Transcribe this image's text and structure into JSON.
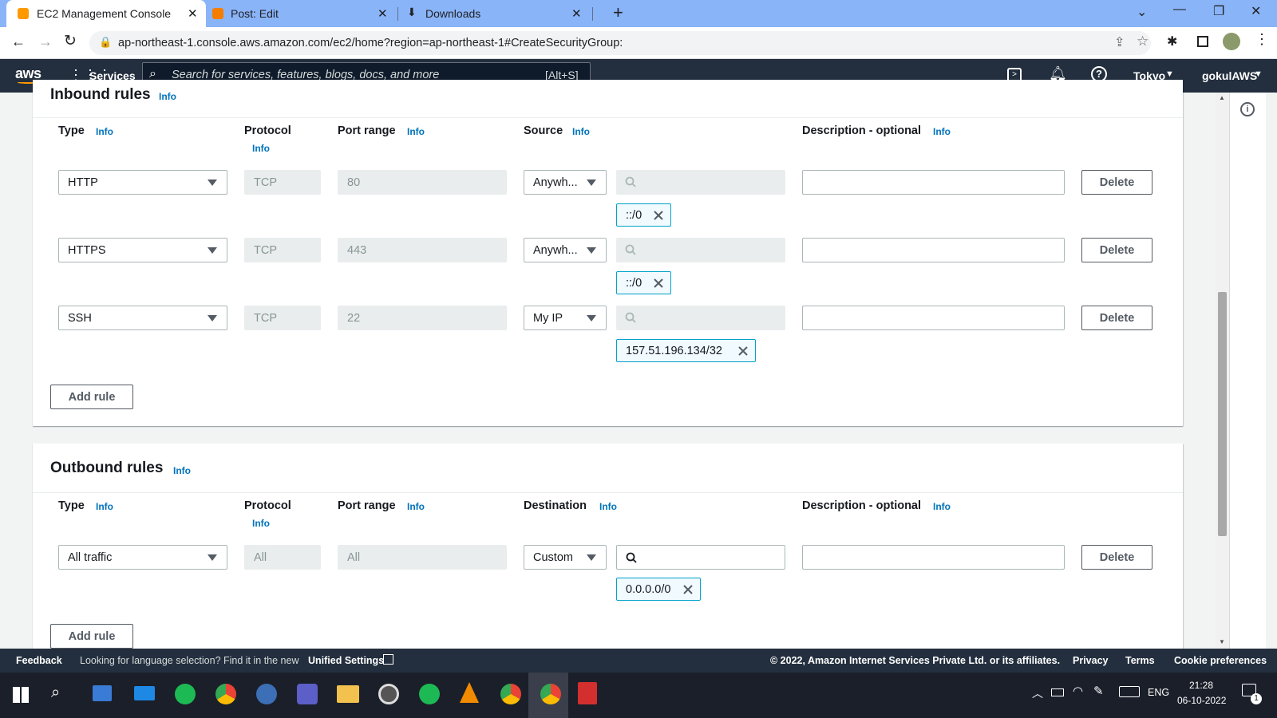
{
  "browser": {
    "tabs": [
      {
        "title": "EC2 Management Console",
        "active": true
      },
      {
        "title": "Post: Edit",
        "active": false
      },
      {
        "title": "Downloads",
        "active": false
      }
    ],
    "url": "ap-northeast-1.console.aws.amazon.com/ec2/home?region=ap-northeast-1#CreateSecurityGroup:"
  },
  "aws_nav": {
    "logo": "aws",
    "services": "Services",
    "search_placeholder": "Search for services, features, blogs, docs, and more",
    "search_shortcut": "[Alt+S]",
    "region": "Tokyo",
    "user": "gokulAWS"
  },
  "inbound": {
    "title": "Inbound rules",
    "info": "Info",
    "headers": {
      "type": "Type",
      "protocol": "Protocol",
      "port_range": "Port range",
      "source": "Source",
      "description": "Description - optional"
    },
    "rules": [
      {
        "type": "HTTP",
        "protocol": "TCP",
        "port": "80",
        "source": "Anywh...",
        "cidr": "::/0",
        "delete": "Delete"
      },
      {
        "type": "HTTPS",
        "protocol": "TCP",
        "port": "443",
        "source": "Anywh...",
        "cidr": "::/0",
        "delete": "Delete"
      },
      {
        "type": "SSH",
        "protocol": "TCP",
        "port": "22",
        "source": "My IP",
        "cidr": "157.51.196.134/32",
        "delete": "Delete"
      }
    ],
    "add_rule": "Add rule"
  },
  "outbound": {
    "title": "Outbound rules",
    "info": "Info",
    "headers": {
      "type": "Type",
      "protocol": "Protocol",
      "port_range": "Port range",
      "destination": "Destination",
      "description": "Description - optional"
    },
    "rules": [
      {
        "type": "All traffic",
        "protocol": "All",
        "port": "All",
        "destination": "Custom",
        "cidr": "0.0.0.0/0",
        "delete": "Delete"
      }
    ],
    "add_rule": "Add rule"
  },
  "footer": {
    "feedback": "Feedback",
    "lang_text": "Looking for language selection? Find it in the new",
    "unified": "Unified Settings",
    "copyright": "© 2022, Amazon Internet Services Private Ltd. or its affiliates.",
    "privacy": "Privacy",
    "terms": "Terms",
    "cookies": "Cookie preferences"
  },
  "taskbar": {
    "lang": "ENG",
    "time": "21:28",
    "date": "06-10-2022",
    "notifications": "1"
  },
  "colors": {
    "aws_nav": "#232f3e",
    "link": "#0073bb",
    "token_border": "#00a1c9",
    "chrome_tabbar": "#8ab4f8"
  }
}
